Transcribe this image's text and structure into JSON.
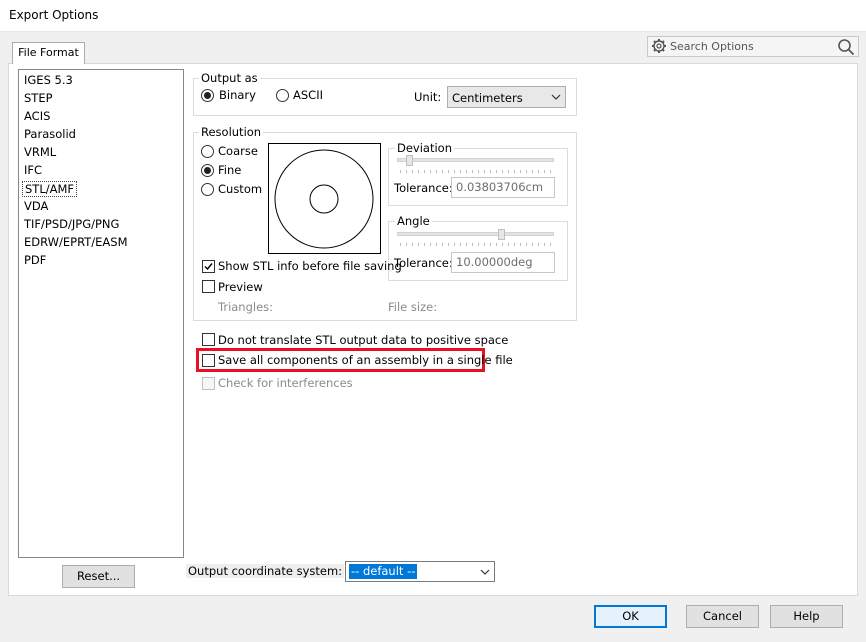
{
  "window": {
    "title": "Export Options"
  },
  "tab": {
    "label": "File Format"
  },
  "search": {
    "placeholder": "Search Options",
    "gear_icon": "gear-icon",
    "search_icon": "search-icon"
  },
  "formats": [
    "IGES 5.3",
    "STEP",
    "ACIS",
    "Parasolid",
    "VRML",
    "IFC",
    "STL/AMF",
    "VDA",
    "TIF/PSD/JPG/PNG",
    "EDRW/EPRT/EASM",
    "PDF"
  ],
  "selected_format": "STL/AMF",
  "reset_label": "Reset...",
  "output_as": {
    "label": "Output as",
    "binary": "Binary",
    "ascii": "ASCII",
    "selected": "Binary",
    "unit_label": "Unit:",
    "unit_value": "Centimeters"
  },
  "resolution": {
    "label": "Resolution",
    "coarse": "Coarse",
    "fine": "Fine",
    "custom": "Custom",
    "selected": "Fine",
    "deviation": {
      "label": "Deviation",
      "tolerance_label": "Tolerance:",
      "tolerance_value": "0.03803706cm"
    },
    "angle": {
      "label": "Angle",
      "tolerance_label": "Tolerance:",
      "tolerance_value": "10.00000deg"
    },
    "show_stl_info": "Show STL info before file saving",
    "preview": "Preview",
    "triangles": "Triangles:",
    "file_size": "File size:"
  },
  "options": {
    "no_translate": "Do not translate STL output data to positive space",
    "save_all": "Save all components of an assembly in a single file",
    "check_interf": "Check for interferences"
  },
  "coord": {
    "label": "Output coordinate system:",
    "value": "-- default --"
  },
  "buttons": {
    "ok": "OK",
    "cancel": "Cancel",
    "help": "Help"
  },
  "colors": {
    "highlight": "#e81123",
    "accent": "#0078d7"
  }
}
